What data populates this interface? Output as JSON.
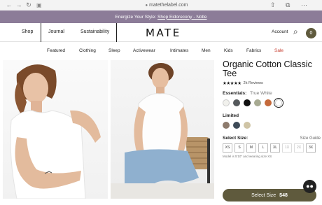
{
  "browser": {
    "url": "matethelabel.com",
    "icons": {
      "back": "arrow-left-icon",
      "forward": "arrow-right-icon",
      "reload": "reload-icon",
      "tabs": "tabs-icon",
      "lock": "lock-icon",
      "share": "share-icon",
      "new_tab": "tab-count-icon",
      "more": "more-icon"
    }
  },
  "promo": {
    "text": "Energize Your Style:",
    "link": "Shop Eidorecony - Notle"
  },
  "header": {
    "links": [
      "Shop",
      "Journal",
      "Sustainability"
    ],
    "logo": "MATE",
    "account": "Account",
    "icons": {
      "search": "search-icon",
      "cart": "cart-icon"
    },
    "cart_count": "0",
    "accent": "#5f5a3d"
  },
  "categories": [
    "Featured",
    "Clothing",
    "Sleep",
    "Activewear",
    "Intimates",
    "Men",
    "Kids",
    "Fabrics",
    "Sale"
  ],
  "product": {
    "title": "Organic Cotton Classic Tee",
    "stars": "★★★★★",
    "reviews": "2k Reviews",
    "essentials_label": "Essentials:",
    "essentials_value": "True White",
    "essentials_colors": [
      "#f1f1ed",
      "#55595c",
      "#111111",
      "#a7aa92",
      "#c56a3b",
      "#ffffff"
    ],
    "limited_label": "Limited",
    "limited_colors": [
      "#8d7b6d",
      "#3d4a57",
      "#cfc4a5"
    ],
    "size_label": "Select Size:",
    "size_guide": "Size Guide",
    "sizes": [
      "XS",
      "S",
      "M",
      "L",
      "XL",
      "1X",
      "2X",
      "3X"
    ],
    "sizes_oos": [
      false,
      false,
      false,
      false,
      false,
      true,
      true,
      false
    ],
    "size_note": "Model is 5'10\" and wearing size XS",
    "add_label": "Select Size",
    "price": "$48"
  },
  "chat_icon": "chat-icon"
}
